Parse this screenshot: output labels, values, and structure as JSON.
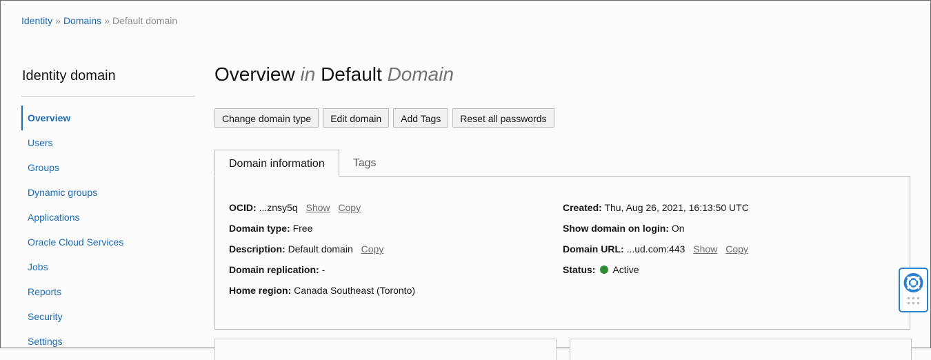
{
  "breadcrumb": {
    "items": [
      "Identity",
      "Domains"
    ],
    "current": "Default domain",
    "separator": "»"
  },
  "sidebar": {
    "title": "Identity domain",
    "items": [
      {
        "label": "Overview"
      },
      {
        "label": "Users"
      },
      {
        "label": "Groups"
      },
      {
        "label": "Dynamic groups"
      },
      {
        "label": "Applications"
      },
      {
        "label": "Oracle Cloud Services"
      },
      {
        "label": "Jobs"
      },
      {
        "label": "Reports"
      },
      {
        "label": "Security"
      },
      {
        "label": "Settings"
      }
    ],
    "active_index": 0
  },
  "page": {
    "title_main": "Overview",
    "title_in": "in",
    "title_domain_name": "Default",
    "title_domain_word": "Domain"
  },
  "toolbar": {
    "change_domain_type": "Change domain type",
    "edit_domain": "Edit domain",
    "add_tags": "Add Tags",
    "reset_passwords": "Reset all passwords"
  },
  "tabs": [
    {
      "label": "Domain information"
    },
    {
      "label": "Tags"
    }
  ],
  "info": {
    "ocid_label": "OCID:",
    "ocid_value": "...znsy5q",
    "show_label": "Show",
    "copy_label": "Copy",
    "domain_type_label": "Domain type:",
    "domain_type_value": "Free",
    "description_label": "Description:",
    "description_value": "Default domain",
    "replication_label": "Domain replication:",
    "replication_value": "-",
    "home_region_label": "Home region:",
    "home_region_value": "Canada Southeast (Toronto)",
    "created_label": "Created:",
    "created_value": "Thu, Aug 26, 2021, 16:13:50 UTC",
    "show_on_login_label": "Show domain on login:",
    "show_on_login_value": "On",
    "domain_url_label": "Domain URL:",
    "domain_url_value": "...ud.com:443",
    "status_label": "Status:",
    "status_value": "Active"
  },
  "colors": {
    "link": "#1c6bb5",
    "status_active": "#2e8b35",
    "help_accent": "#2a7fd1"
  },
  "icons": {
    "help": "lifebuoy-icon",
    "help_drag": "drag-grid-icon"
  }
}
